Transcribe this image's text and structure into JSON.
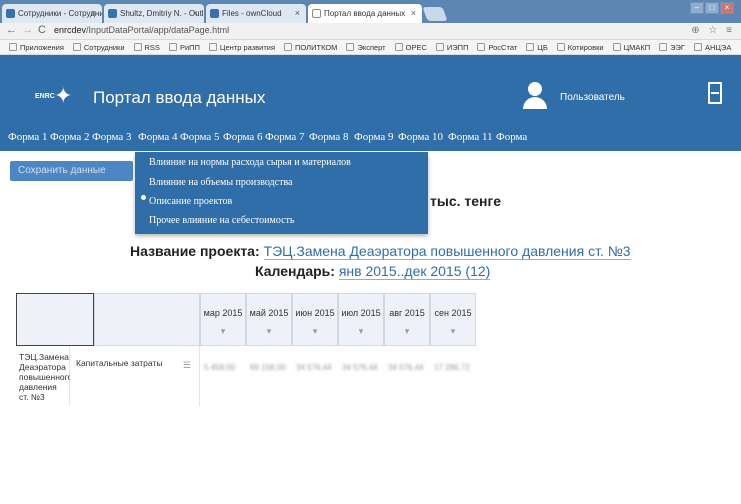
{
  "browser": {
    "tabs": [
      {
        "label": "Сотрудники - Сотрудни"
      },
      {
        "label": "Shultz, Dmitriy N. - Outlo"
      },
      {
        "label": "Files - ownCloud"
      },
      {
        "label": "Портал ввода данных"
      }
    ],
    "url_host": "enrcdev",
    "url_path": "/InputDataPortal/app/dataPage.html",
    "bookmarks": [
      "Приложения",
      "Сотрудники",
      "RSS",
      "РиПП",
      "Центр развития",
      "ПОЛИТКОМ",
      "Эксперт",
      "ОРЕС",
      "ИЭПП",
      "РосСтат",
      "ЦБ",
      "Котировки",
      "ЦМАКП",
      "ЭЭГ",
      "АНЦЭА"
    ]
  },
  "header": {
    "logo_text": "ENRC",
    "title": "Портал ввода данных",
    "user_label": "Пользователь"
  },
  "menu": [
    "Форма 1",
    "Форма 2",
    "Форма 3",
    "Форма 4",
    "Форма 5",
    "Форма 6",
    "Форма 7",
    "Форма 8",
    "Форма 9",
    "Форма 10",
    "Форма 11",
    "Форма"
  ],
  "toolbar": {
    "save_label": "Сохранить данные"
  },
  "dropdown": {
    "items": [
      "Влияние на нормы расхода сырья и материалов",
      "Влияние на объемы производства",
      "Описание проектов",
      "Прочее влияние на себестоимость"
    ],
    "selected": "Описание проектов"
  },
  "page": {
    "subheading": "тыс. тенге",
    "project_label": "Название проекта:",
    "project_value": "ТЭЦ.Замена Деаэратора повышенного давления ст. №3",
    "calendar_label": "Календарь:",
    "calendar_value": "янв 2015..дек 2015 (12)"
  },
  "table": {
    "columns": [
      "мар 2015",
      "май 2015",
      "июн 2015",
      "июл 2015",
      "авг 2015",
      "сен 2015"
    ],
    "row": {
      "project": "ТЭЦ.Замена Деаэратора повышенного давления ст. №3",
      "type": "Капитальные затраты",
      "values": [
        "5 458,00",
        "69 158,00",
        "34 576,44",
        "34 576,44",
        "34 576,44",
        "17 286,72"
      ]
    }
  }
}
